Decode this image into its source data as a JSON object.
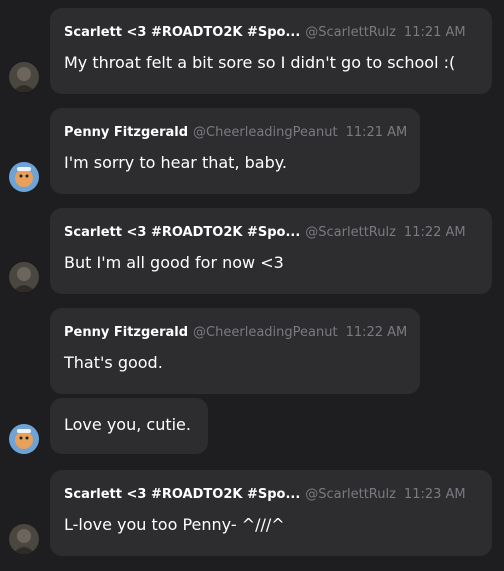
{
  "messages": [
    {
      "name": "Scarlett <3 #ROADTO2K #Spo...",
      "handle": "@ScarlettRulz",
      "time": "11:21 AM",
      "text": "My throat felt a bit sore so I didn't go to school :("
    },
    {
      "name": "Penny Fitzgerald",
      "handle": "@CheerleadingPeanut",
      "time": "11:21 AM",
      "text": "I'm sorry to hear that, baby."
    },
    {
      "name": "Scarlett <3 #ROADTO2K #Spo...",
      "handle": "@ScarlettRulz",
      "time": "11:22 AM",
      "text": "But I'm all good for now <3"
    },
    {
      "name": "Penny Fitzgerald",
      "handle": "@CheerleadingPeanut",
      "time": "11:22 AM",
      "text": "That's good."
    },
    {
      "text": "Love you, cutie."
    },
    {
      "name": "Scarlett <3 #ROADTO2K #Spo...",
      "handle": "@ScarlettRulz",
      "time": "11:23 AM",
      "text": "L-love you too Penny- ^///^"
    }
  ]
}
